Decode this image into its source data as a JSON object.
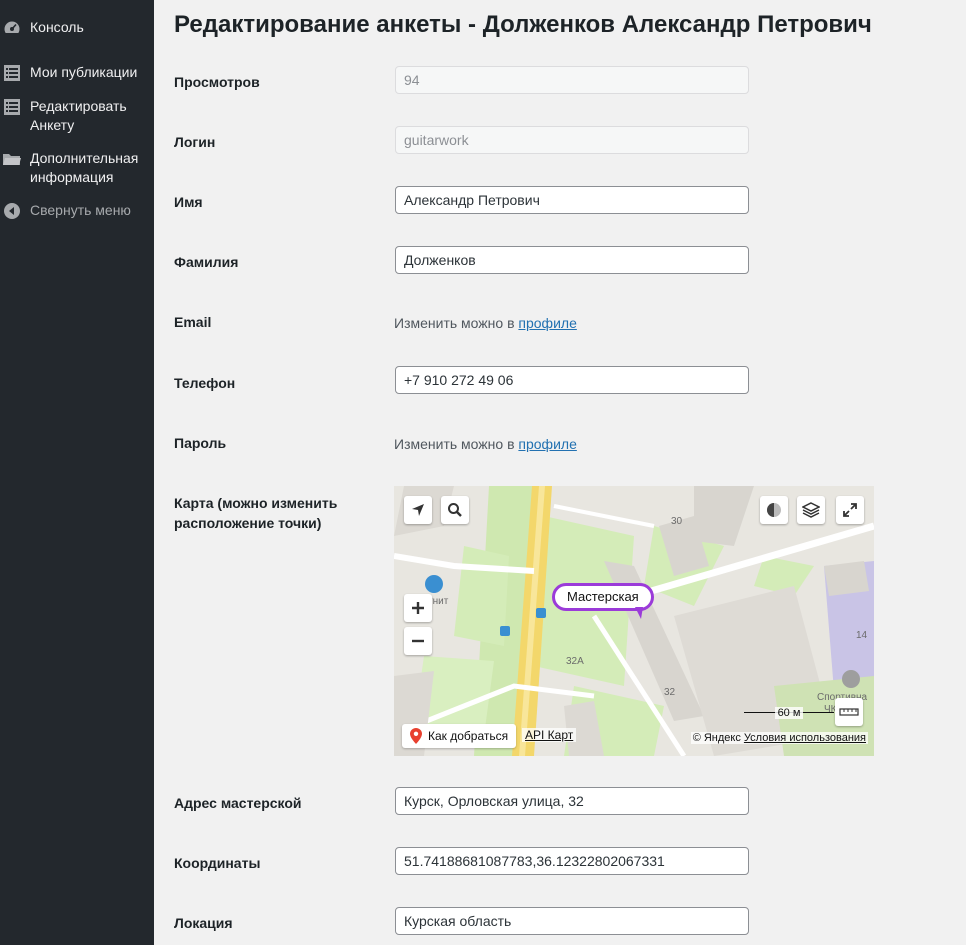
{
  "sidebar": {
    "items": [
      {
        "label": "Консоль",
        "icon": "dashboard-icon"
      },
      {
        "label": "Мои публикации",
        "icon": "list-icon"
      },
      {
        "label": "Редактировать Анкету",
        "icon": "list-icon"
      },
      {
        "label": "Дополнительная информация",
        "icon": "folder-icon"
      }
    ],
    "collapse_label": "Свернуть меню"
  },
  "page": {
    "title": "Редактирование анкеты - Долженков Александр Петрович"
  },
  "form": {
    "views": {
      "label": "Просмотров",
      "value": "94"
    },
    "login": {
      "label": "Логин",
      "value": "guitarwork"
    },
    "name": {
      "label": "Имя",
      "value": "Александр Петрович"
    },
    "surname": {
      "label": "Фамилия",
      "value": "Долженков"
    },
    "email": {
      "label": "Email",
      "note": "Изменить можно в ",
      "link": "профиле"
    },
    "phone": {
      "label": "Телефон",
      "value": "+7 910 272 49 06"
    },
    "password": {
      "label": "Пароль",
      "note": "Изменить можно в ",
      "link": "профиле"
    },
    "map": {
      "label": "Карта (можно изменить расположение точки)"
    },
    "address": {
      "label": "Адрес мастерской",
      "value": "Курск, Орловская улица, 32"
    },
    "coords": {
      "label": "Координаты",
      "value": "51.74188681087783,36.12322802067331"
    },
    "location": {
      "label": "Локация",
      "value": "Курская область"
    }
  },
  "map": {
    "pin_label": "Мастерская",
    "route_button": "Как добраться",
    "api_link": "API Карт",
    "copyright": "© Яндекс ",
    "terms_link": "Условия использования",
    "scale": "60 м",
    "building_numbers": [
      "30",
      "32А",
      "32",
      "14"
    ],
    "place_labels": [
      "гнит",
      "Спортивна",
      "ЧКОЛ"
    ],
    "pin_color": "#9b3bd9"
  },
  "colors": {
    "sidebar_bg": "#23282d",
    "link": "#2271b1"
  }
}
